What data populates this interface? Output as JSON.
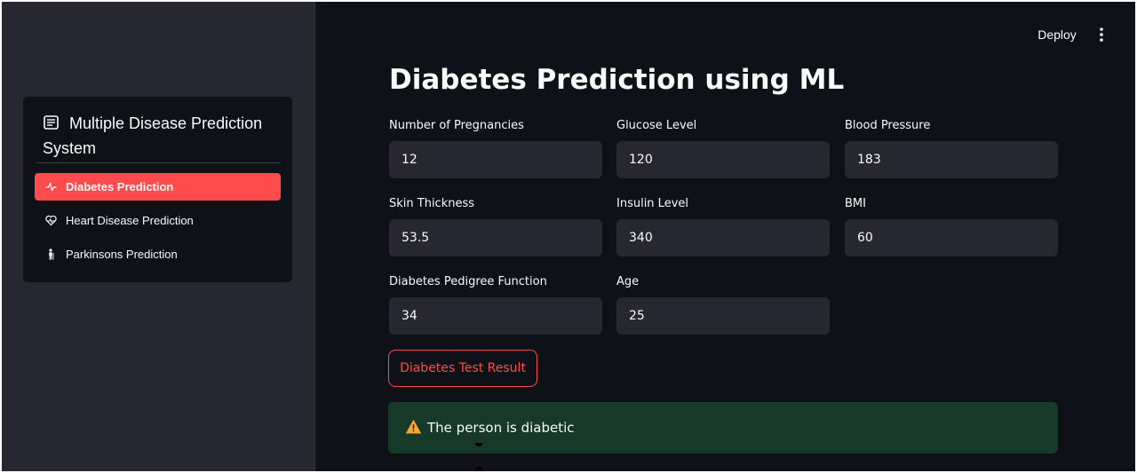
{
  "topbar": {
    "deploy_label": "Deploy",
    "menu_icon": "vertical-dots-icon"
  },
  "sidebar": {
    "header": {
      "icon": "notepad-icon",
      "title": "Multiple Disease Prediction System"
    },
    "items": [
      {
        "label": "Diabetes Prediction",
        "icon": "activity-icon",
        "active": true
      },
      {
        "label": "Heart Disease Prediction",
        "icon": "heart-pulse-icon",
        "active": false
      },
      {
        "label": "Parkinsons Prediction",
        "icon": "person-icon",
        "active": false
      }
    ]
  },
  "main": {
    "title": "Diabetes Prediction using ML",
    "fields": [
      {
        "label": "Number of Pregnancies",
        "value": "12"
      },
      {
        "label": "Glucose Level",
        "value": "120"
      },
      {
        "label": "Blood Pressure",
        "value": "183"
      },
      {
        "label": "Skin Thickness",
        "value": "53.5"
      },
      {
        "label": "Insulin Level",
        "value": "340"
      },
      {
        "label": "BMI",
        "value": "60"
      },
      {
        "label": "Diabetes Pedigree Function",
        "value": "34"
      },
      {
        "label": "Age",
        "value": "25"
      }
    ],
    "button_label": "Diabetes Test Result",
    "result": {
      "icon": "warning-icon",
      "text": "The person is diabetic"
    }
  },
  "colors": {
    "accent": "#ff4b4b",
    "background": "#0e1117",
    "sidebar": "#262730",
    "input": "#262730",
    "alert_bg": "#173928",
    "text": "#fafafa"
  }
}
